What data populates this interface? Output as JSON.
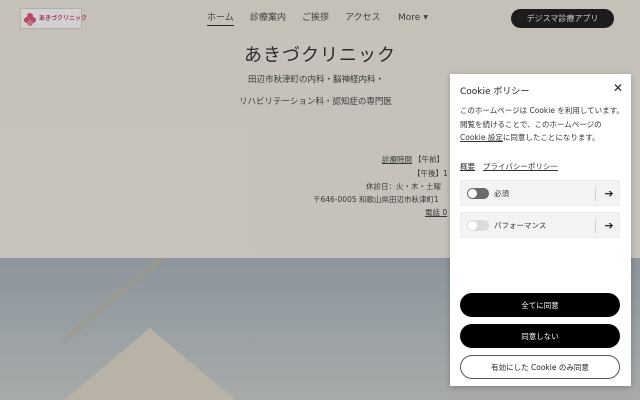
{
  "header": {
    "logo": {
      "subtitle": "",
      "name": "あきづクリニック"
    },
    "nav": [
      {
        "label": "ホーム",
        "active": true
      },
      {
        "label": "診療案内",
        "active": false
      },
      {
        "label": "ご挨拶",
        "active": false
      },
      {
        "label": "アクセス",
        "active": false
      },
      {
        "label": "More",
        "active": false
      }
    ],
    "app_button": "デジスマ診療アプリ"
  },
  "hero": {
    "title": "あきづクリニック",
    "tagline_1": "田辺市秋津町の内科・脳神経内科・",
    "tagline_2": "リハビリテーション科・認知症の専門医",
    "hours_label": "診療時間",
    "hours_am": "【午前】",
    "hours_pm": "【午後】1",
    "closed": "休診日：火・木・土曜",
    "address": "〒646-0005 和歌山県田辺市秋津町1",
    "phone": "電話 0"
  },
  "cookie_panel": {
    "title": "Cookie ポリシー",
    "description_part1": "このホームページは Cookie を利用しています。閲覧を続けることで、このホームページの ",
    "description_link": "Cookie 設定",
    "description_part2": "に同意したことになります。",
    "link_summary": "概要",
    "link_privacy": "プライバシーポリシー",
    "categories": [
      {
        "label": "必須",
        "enabled": true
      },
      {
        "label": "パフォーマンス",
        "enabled": false
      }
    ],
    "accept_all": "全てに同意",
    "reject": "同意しない",
    "accept_selected": "有効にした Cookie のみ同意"
  },
  "colors": {
    "overlay": "rgba(0,0,0,0.16)",
    "button_dark": "#000000",
    "accent_logo": "#c64468"
  },
  "icons": {
    "close": "close-icon",
    "arrow": "arrow-right-icon",
    "more": "chevron-down-icon"
  }
}
